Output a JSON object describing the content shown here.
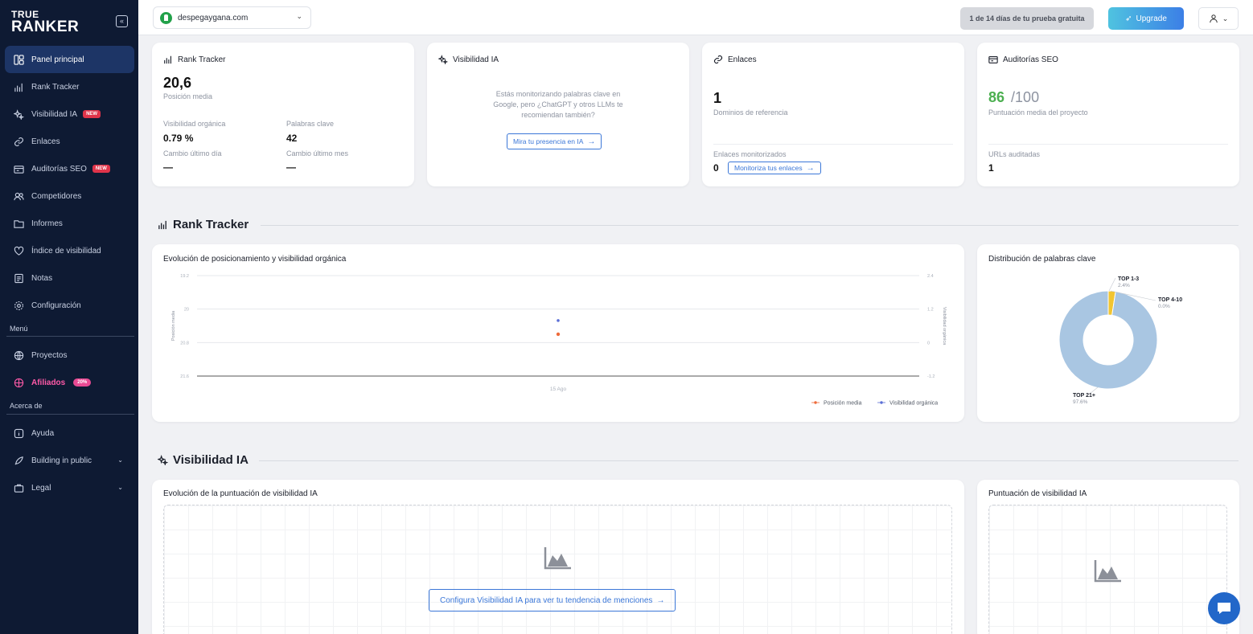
{
  "sidebar": {
    "logo_top": "TRUE",
    "logo_bottom": "RANKER",
    "items": [
      {
        "label": "Panel principal"
      },
      {
        "label": "Rank Tracker"
      },
      {
        "label": "Visibilidad IA",
        "badge": "NEW"
      },
      {
        "label": "Enlaces"
      },
      {
        "label": "Auditorías SEO",
        "badge": "NEW"
      },
      {
        "label": "Competidores"
      },
      {
        "label": "Informes"
      },
      {
        "label": "Índice de visibilidad"
      },
      {
        "label": "Notas"
      },
      {
        "label": "Configuración"
      }
    ],
    "menu_label": "Menú",
    "menu_items": [
      {
        "label": "Proyectos"
      },
      {
        "label": "Afiliados",
        "badge": "20%"
      }
    ],
    "about_label": "Acerca de",
    "about_items": [
      {
        "label": "Ayuda"
      },
      {
        "label": "Building in public"
      },
      {
        "label": "Legal"
      }
    ]
  },
  "topbar": {
    "project": "despegaygana.com",
    "trial": "1 de 14 días de tu prueba gratuita",
    "upgrade": "Upgrade"
  },
  "cards": {
    "rank": {
      "title": "Rank Tracker",
      "avg_position": "20,6",
      "avg_label": "Posición media",
      "vis_label": "Visibilidad orgánica",
      "vis_value": "0.79 %",
      "kw_label": "Palabras clave",
      "kw_value": "42",
      "day_label": "Cambio último día",
      "day_value": "—",
      "month_label": "Cambio último mes",
      "month_value": "—"
    },
    "ia": {
      "title": "Visibilidad IA",
      "text1": "Estás monitorizando palabras clave en",
      "text2": "Google, pero ¿ChatGPT y otros LLMs te",
      "text3": "recomiendan también?",
      "button": "Mira tu presencia en IA"
    },
    "links": {
      "title": "Enlaces",
      "domains_value": "1",
      "domains_label": "Dominios de referencia",
      "monitored_label": "Enlaces monitorizados",
      "monitored_value": "0",
      "button": "Monitoriza tus enlaces"
    },
    "audit": {
      "title": "Auditorías SEO",
      "score": "86",
      "score_max": "/100",
      "score_label": "Puntuación media del proyecto",
      "urls_label": "URLs auditadas",
      "urls_value": "1"
    }
  },
  "sections": {
    "rank_tracker": "Rank Tracker",
    "visibilidad": "Visibilidad IA"
  },
  "evolution": {
    "title": "Evolución de posicionamiento y visibilidad orgánica",
    "y_left_label": "Posición media",
    "y_right_label": "Visibilidad orgánica"
  },
  "distribution": {
    "title": "Distribución de palabras clave"
  },
  "ia_evolution": {
    "title": "Evolución de la puntuación de visibilidad IA",
    "button": "Configura Visibilidad IA para ver tu tendencia de menciones"
  },
  "ia_score": {
    "title": "Puntuación de visibilidad IA"
  },
  "chart_data": [
    {
      "type": "line",
      "title": "Evolución de posicionamiento y visibilidad orgánica",
      "x": [
        "15 Ago"
      ],
      "series": [
        {
          "name": "Posición media",
          "values": [
            20.6
          ],
          "color": "#ee6b3b",
          "axis": "left"
        },
        {
          "name": "Visibilidad orgánica",
          "values": [
            0.79
          ],
          "color": "#5b6fd6",
          "axis": "right"
        }
      ],
      "y_left": {
        "label": "Posición media",
        "ticks": [
          "19.2",
          "20",
          "20.8",
          "21.6"
        ],
        "range": [
          19.2,
          21.6
        ],
        "inverted": true
      },
      "y_right": {
        "label": "Visibilidad orgánica",
        "ticks": [
          "2.4",
          "1.2",
          "0",
          "-1.2"
        ],
        "range": [
          -1.2,
          2.4
        ]
      },
      "legend": "bottom-right"
    },
    {
      "type": "pie",
      "title": "Distribución de palabras clave",
      "slices": [
        {
          "label": "TOP 1-3",
          "value": 2.4,
          "display": "2.4%",
          "color": "#f2c531"
        },
        {
          "label": "TOP 4-10",
          "value": 0.0,
          "display": "0.0%",
          "color": "#e7eef6"
        },
        {
          "label": "TOP 21+",
          "value": 97.6,
          "display": "97.6%",
          "color": "#a9c6e2"
        }
      ]
    }
  ]
}
